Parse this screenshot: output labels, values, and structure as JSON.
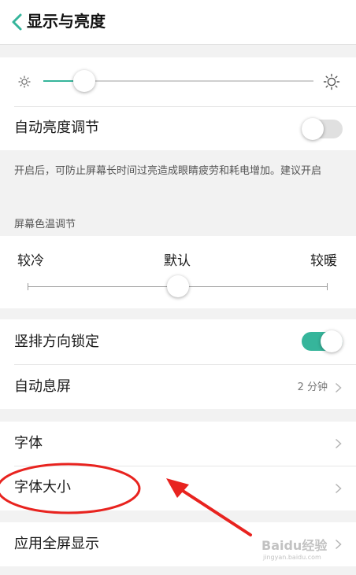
{
  "header": {
    "title": "显示与亮度"
  },
  "brightness": {
    "level_fraction": 0.15
  },
  "auto_brightness": {
    "label": "自动亮度调节",
    "enabled": false,
    "description": "开启后，可防止屏幕长时间过亮造成眼睛疲劳和耗电增加。建议开启"
  },
  "color_temperature": {
    "section_title": "屏幕色温调节",
    "cold_label": "较冷",
    "default_label": "默认",
    "warm_label": "较暖",
    "level_fraction": 0.5
  },
  "portrait_lock": {
    "label": "竖排方向锁定",
    "enabled": true
  },
  "auto_sleep": {
    "label": "自动息屏",
    "value": "2 分钟"
  },
  "font": {
    "label": "字体"
  },
  "font_size": {
    "label": "字体大小"
  },
  "fullscreen_apps": {
    "label": "应用全屏显示"
  },
  "watermark": {
    "text": "Baidu经验",
    "url_text": "jingyan.baidu.com"
  },
  "colors": {
    "accent": "#36b59b",
    "annotation": "#e8231f",
    "toggle_off": "#e0e0e0"
  }
}
